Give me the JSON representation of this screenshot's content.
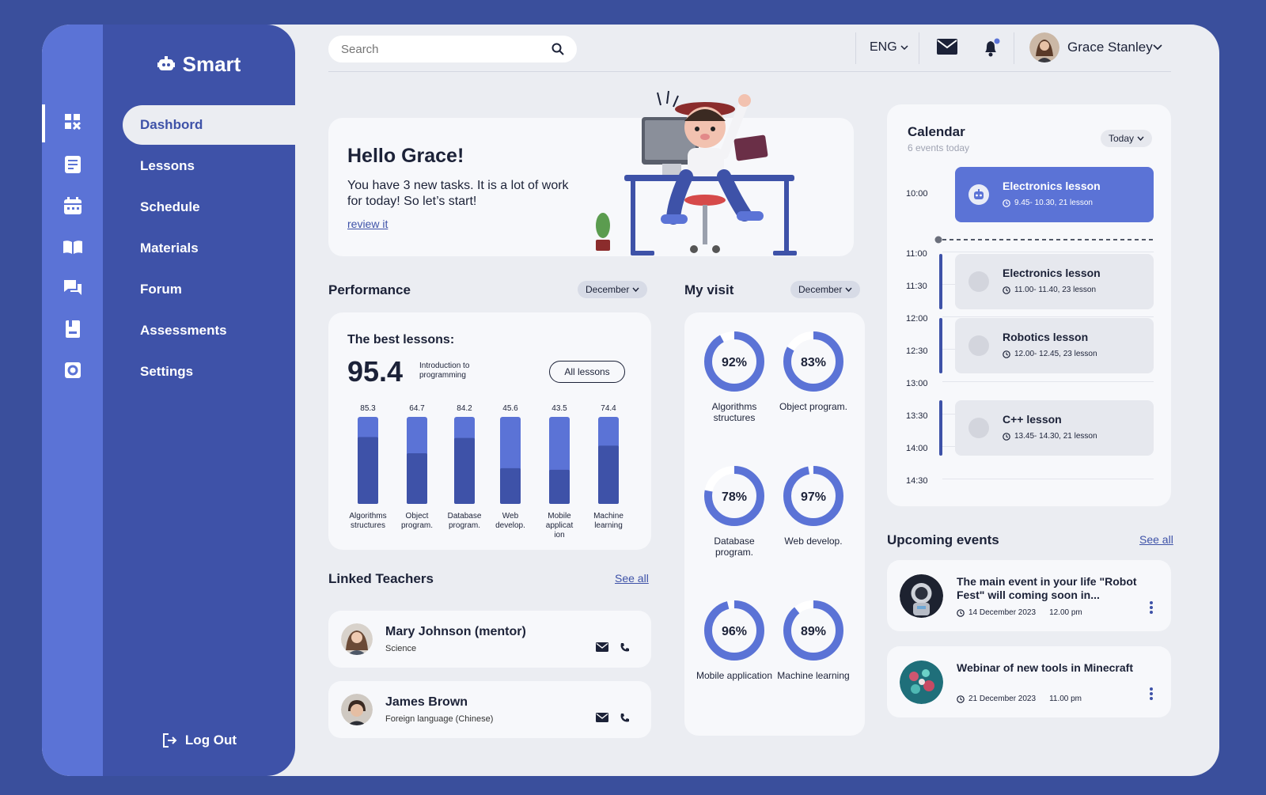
{
  "app": {
    "logo": "Smart"
  },
  "nav": {
    "items": [
      {
        "label": "Dashbord",
        "icon": "dashboard-icon"
      },
      {
        "label": "Lessons",
        "icon": "lessons-icon"
      },
      {
        "label": "Schedule",
        "icon": "calendar-icon"
      },
      {
        "label": "Materials",
        "icon": "book-icon"
      },
      {
        "label": "Forum",
        "icon": "chat-icon"
      },
      {
        "label": "Assessments",
        "icon": "assessment-icon"
      },
      {
        "label": "Settings",
        "icon": "gear-icon"
      }
    ],
    "logout": "Log Out"
  },
  "header": {
    "search_placeholder": "Search",
    "language": "ENG",
    "user_name": "Grace Stanley"
  },
  "hello": {
    "title": "Hello Grace!",
    "text": "You have 3 new tasks. It is a lot of work for today! So let’s start!",
    "link": "review it"
  },
  "performance": {
    "title": "Performance",
    "month": "December",
    "best_title": "The best lessons:",
    "best_value": "95.4",
    "best_subject": "Introduction to programming",
    "all_button": "All lessons"
  },
  "chart_data": {
    "type": "bar",
    "categories": [
      "Algorithms structures",
      "Object program.",
      "Database program.",
      "Web develop.",
      "Mobile applicat ion",
      "Machine learning"
    ],
    "values": [
      85.3,
      64.7,
      84.2,
      45.6,
      43.5,
      74.4
    ],
    "value_labels": [
      "85.3",
      "64.7",
      "84.2",
      "45.6",
      "43.5",
      "74.4"
    ],
    "ylim": [
      0,
      100
    ],
    "colors": {
      "fill": "#3e52a8",
      "track": "#5b73d6"
    }
  },
  "visit": {
    "title": "My visit",
    "month": "December",
    "items": [
      {
        "label": "Algorithms structures",
        "value": 92,
        "text": "92%"
      },
      {
        "label": "Object program.",
        "value": 83,
        "text": "83%"
      },
      {
        "label": "Database program.",
        "value": 78,
        "text": "78%"
      },
      {
        "label": "Web develop.",
        "value": 97,
        "text": "97%"
      },
      {
        "label": "Mobile application",
        "value": 96,
        "text": "96%"
      },
      {
        "label": "Machine learning",
        "value": 89,
        "text": "89%"
      }
    ]
  },
  "teachers": {
    "title": "Linked Teachers",
    "see_all": "See all",
    "items": [
      {
        "name": "Mary Johnson (mentor)",
        "subject": "Science"
      },
      {
        "name": "James Brown",
        "subject": "Foreign language (Chinese)"
      }
    ]
  },
  "calendar": {
    "title": "Calendar",
    "subtitle": "6 events today",
    "filter": "Today",
    "times": [
      "10:00",
      "11:00",
      "11:30",
      "12:00",
      "12:30",
      "13:00",
      "13:30",
      "14:00",
      "14:30"
    ],
    "events": [
      {
        "title": "Electronics lesson",
        "meta": "9.45- 10.30, 21 lesson"
      },
      {
        "title": "Electronics lesson",
        "meta": "11.00- 11.40, 23 lesson"
      },
      {
        "title": "Robotics lesson",
        "meta": "12.00- 12.45, 23 lesson"
      },
      {
        "title": "C++ lesson",
        "meta": "13.45- 14.30, 21 lesson"
      }
    ]
  },
  "upcoming": {
    "title": "Upcoming events",
    "see_all": "See all",
    "items": [
      {
        "title": "The main event in your life \"Robot Fest\" will coming soon in...",
        "date": "14 December 2023",
        "time": "12.00 pm"
      },
      {
        "title": "Webinar of new tools in Minecraft",
        "date": "21 December 2023",
        "time": "11.00 pm"
      }
    ]
  },
  "colors": {
    "accent": "#3e52a8",
    "accent_light": "#5b73d6",
    "background": "#ebedf2",
    "card": "#f7f8fb"
  }
}
